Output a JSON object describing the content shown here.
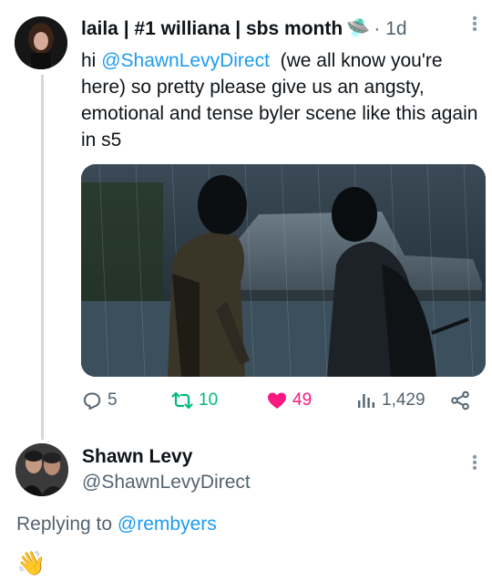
{
  "tweet1": {
    "display_name": "laila | #1 williana | sbs month",
    "name_emoji": "🛸",
    "separator": "·",
    "time": "1d",
    "text_prefix": "hi ",
    "mention": "@ShawnLevyDirect",
    "text_suffix": "  (we all know you're here) so pretty please give us an angsty, emotional and tense byler scene like this again in s5",
    "stats": {
      "replies": "5",
      "retweets": "10",
      "likes": "49",
      "views": "1,429"
    }
  },
  "tweet2": {
    "display_name": "Shawn Levy",
    "handle": "@ShawnLevyDirect",
    "replying_prefix": "Replying to ",
    "replying_to": "@rembyers",
    "body_emoji": "👋"
  },
  "icons": {
    "more": "more-vertical-icon",
    "reply": "reply-icon",
    "retweet": "retweet-icon",
    "like": "heart-icon",
    "views": "analytics-icon",
    "share": "share-icon"
  },
  "colors": {
    "link": "#1d9bf0",
    "retweet": "#00ba7c",
    "like": "#f91880",
    "muted": "#536471"
  }
}
